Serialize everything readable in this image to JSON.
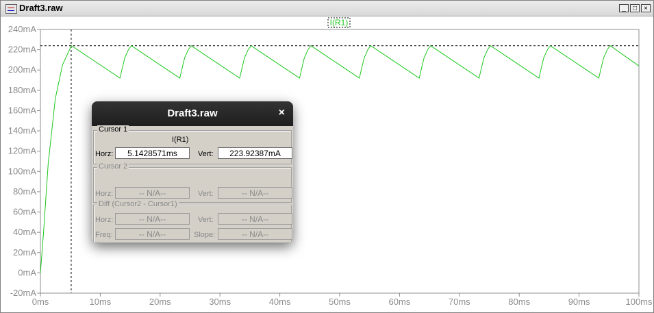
{
  "window": {
    "title": "Draft3.raw"
  },
  "window_buttons": {
    "minimize": "_",
    "maximize": "□",
    "close": "×"
  },
  "trace": {
    "name": "I(R1)",
    "color": "#19c619"
  },
  "colors": {
    "axis_text": "#8c8c8c",
    "grid": "#000000"
  },
  "chart_data": {
    "type": "line",
    "xlabel": "",
    "ylabel": "",
    "xlim": [
      0,
      100
    ],
    "ylim": [
      -20,
      240
    ],
    "x_ticks": [
      "0ms",
      "10ms",
      "20ms",
      "30ms",
      "40ms",
      "50ms",
      "60ms",
      "70ms",
      "80ms",
      "90ms",
      "100ms"
    ],
    "y_ticks": [
      "240mA",
      "220mA",
      "200mA",
      "180mA",
      "160mA",
      "140mA",
      "120mA",
      "100mA",
      "80mA",
      "60mA",
      "40mA",
      "20mA",
      "0mA",
      "-20mA"
    ],
    "cursor": {
      "x": 5.1428571,
      "y": 223.92387
    },
    "series": [
      {
        "name": "I(R1)",
        "x": [
          0,
          0.5,
          1.3,
          2.5,
          3.7,
          4.7,
          5.2,
          13.3,
          13.6,
          14.1,
          14.7,
          15.2,
          23.3,
          23.6,
          24.1,
          24.7,
          25.2,
          33.3,
          33.6,
          34.1,
          34.7,
          35.2,
          43.3,
          43.6,
          44.1,
          44.7,
          45.2,
          53.3,
          53.6,
          54.1,
          54.7,
          55.2,
          63.3,
          63.6,
          64.1,
          64.7,
          65.2,
          73.3,
          73.6,
          74.1,
          74.7,
          75.2,
          83.3,
          83.6,
          84.1,
          84.7,
          85.2,
          93.3,
          93.6,
          94.1,
          94.7,
          95.2,
          100
        ],
        "y": [
          0,
          38,
          108,
          172,
          205,
          218,
          224,
          192,
          200,
          212,
          220,
          224,
          192,
          200,
          212,
          220,
          224,
          192,
          200,
          212,
          220,
          224,
          192,
          200,
          212,
          220,
          224,
          192,
          200,
          212,
          220,
          224,
          192,
          200,
          212,
          220,
          224,
          192,
          200,
          212,
          220,
          224,
          192,
          200,
          212,
          220,
          224,
          192,
          200,
          212,
          220,
          224,
          204
        ]
      }
    ]
  },
  "cursor_dialog": {
    "title": "Draft3.raw",
    "close_glyph": "×",
    "cursor1": {
      "title": "Cursor 1",
      "trace": "I(R1)",
      "horz_label": "Horz:",
      "horz": "5.1428571ms",
      "vert_label": "Vert:",
      "vert": "223.92387mA"
    },
    "cursor2": {
      "title": "Cursor 2",
      "horz_label": "Horz:",
      "horz": "-- N/A--",
      "vert_label": "Vert:",
      "vert": "-- N/A--"
    },
    "diff": {
      "title": "Diff (Cursor2 - Cursor1)",
      "horz_label": "Horz:",
      "horz": "-- N/A--",
      "vert_label": "Vert:",
      "vert": "-- N/A--",
      "freq_label": "Freq:",
      "freq": "-- N/A--",
      "slope_label": "Slope:",
      "slope": "-- N/A--"
    }
  }
}
